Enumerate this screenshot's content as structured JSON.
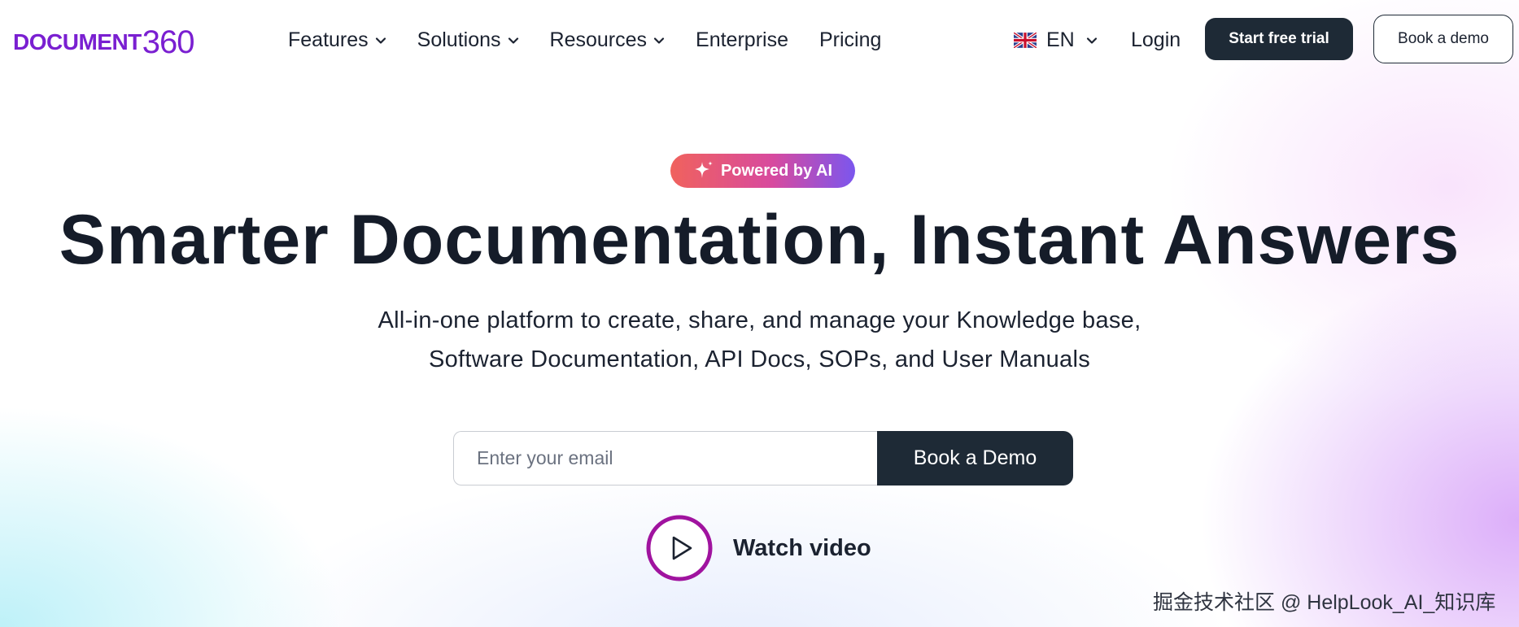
{
  "logo": {
    "text": "DOCUMENT",
    "number": "360"
  },
  "nav": {
    "links": [
      {
        "label": "Features"
      },
      {
        "label": "Solutions"
      },
      {
        "label": "Resources"
      },
      {
        "label": "Enterprise"
      },
      {
        "label": "Pricing"
      }
    ],
    "language": "EN",
    "login": "Login",
    "start_trial": "Start free trial",
    "book_demo": "Book a demo"
  },
  "hero": {
    "badge": "Powered by AI",
    "headline": "Smarter Documentation, Instant Answers",
    "subtitle_line1": "All-in-one platform to create, share, and manage your Knowledge base,",
    "subtitle_line2": "Software Documentation, API Docs, SOPs, and User Manuals",
    "email_placeholder": "Enter your email",
    "book_demo_button": "Book a Demo",
    "watch_video": "Watch video"
  },
  "watermark": "掘金技术社区 @ HelpLook_AI_知识库",
  "colors": {
    "brand_purple": "#7a1fd1",
    "dark_button": "#1e2a36",
    "badge_gradient_start": "#f0625d",
    "badge_gradient_end": "#7b56ee",
    "play_ring": "#a0139f"
  }
}
